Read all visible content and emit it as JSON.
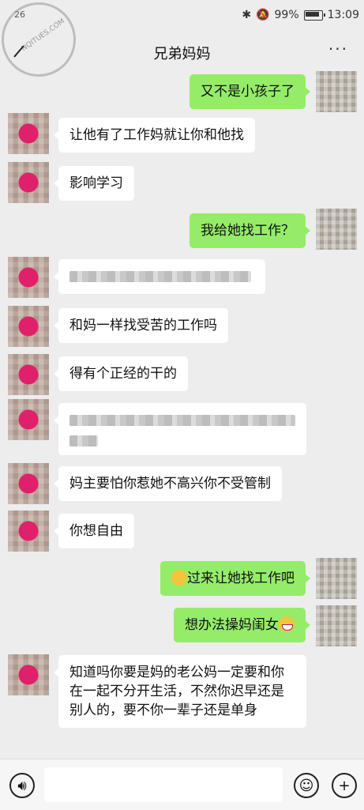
{
  "status": {
    "signal": "26",
    "battery": "99%",
    "time": "13:09"
  },
  "watermark": {
    "text": "NQITUES.COM"
  },
  "header": {
    "title": "兄弟妈妈",
    "more": "···"
  },
  "messages": [
    {
      "side": "right",
      "text": "又不是小孩子了"
    },
    {
      "side": "left",
      "text": "让他有了工作妈就让你和他找"
    },
    {
      "side": "left",
      "text": "影响学习"
    },
    {
      "side": "right",
      "text": "我给她找工作？"
    },
    {
      "side": "left",
      "text": "",
      "blurred": true
    },
    {
      "side": "left",
      "text": "和妈一样找受苦的工作吗"
    },
    {
      "side": "left",
      "text": "得有个正经的干的"
    },
    {
      "side": "left",
      "text": "",
      "blurred": true
    },
    {
      "side": "left",
      "text": "妈主要怕你惹她不高兴你不受管制"
    },
    {
      "side": "left",
      "text": "你想自由"
    },
    {
      "side": "right",
      "text": "过来让她找工作吧",
      "emoji": "face-with-hand-over-mouth"
    },
    {
      "side": "right",
      "text": "想办法操妈闺女",
      "emoji": "grinning-face"
    },
    {
      "side": "left",
      "text": "知道吗你要是妈的老公妈一定要和你在一起不分开生活，不然你迟早还是别人的，要不你一辈子还是单身"
    }
  ],
  "input": {
    "placeholder": ""
  },
  "icons": [
    "voice-icon",
    "emoji-icon",
    "plus-icon",
    "back-icon",
    "more-icon",
    "bluetooth-icon",
    "mute-icon",
    "wifi-icon"
  ]
}
